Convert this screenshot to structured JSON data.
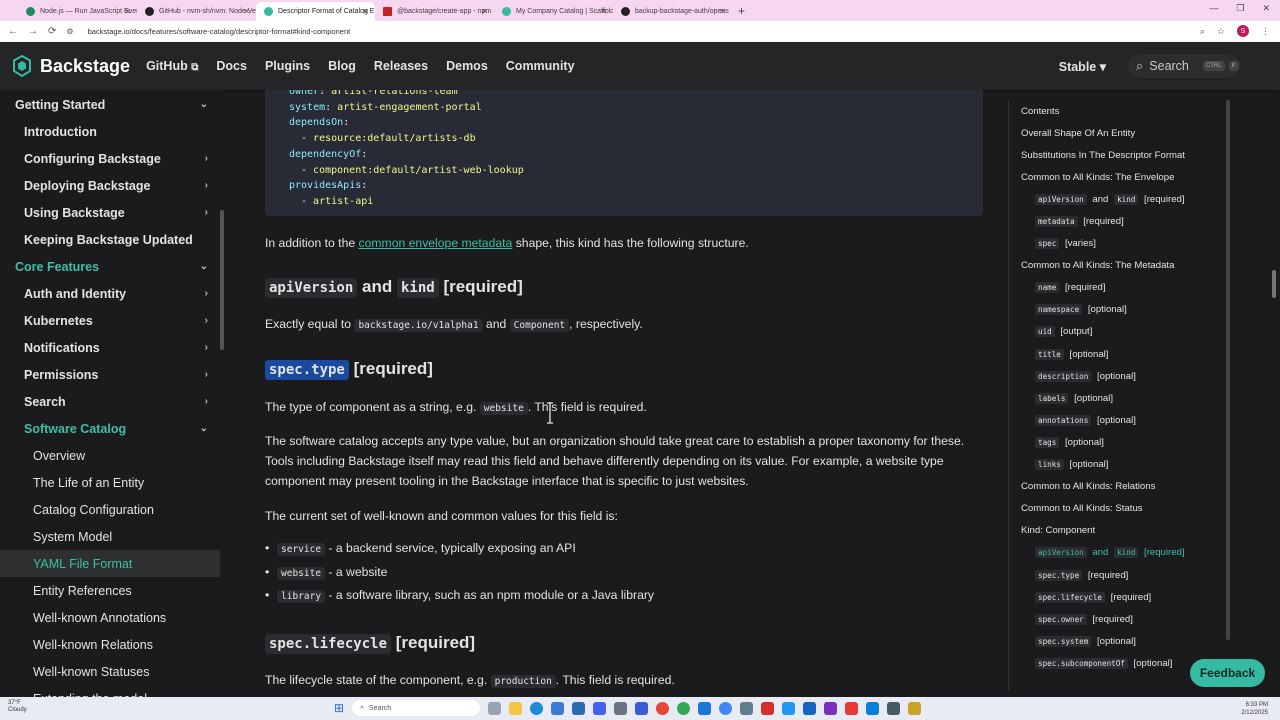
{
  "browser": {
    "tabs": [
      {
        "title": "Node.js — Run JavaScript Every",
        "icon": "node-icon",
        "active": false
      },
      {
        "title": "GitHub - nvm-sh/nvm: Node Ve",
        "icon": "github-icon",
        "active": false
      },
      {
        "title": "Descriptor Format of Catalog E",
        "icon": "backstage-icon",
        "active": true
      },
      {
        "title": "@backstage/create-app - npm",
        "icon": "npm-icon",
        "active": false
      },
      {
        "title": "My Company Catalog | Scaffold",
        "icon": "backstage-icon",
        "active": false
      },
      {
        "title": "backup-backstage-auth/opens",
        "icon": "github-icon",
        "active": false
      }
    ],
    "new_tab": "+",
    "url": "backstage.io/docs/features/software-catalog/descriptor-format#kind-component",
    "profile_initial": "S"
  },
  "navbar": {
    "logo": "Backstage",
    "links": [
      "GitHub",
      "Docs",
      "Plugins",
      "Blog",
      "Releases",
      "Demos",
      "Community"
    ],
    "version": "Stable",
    "search_label": "Search",
    "search_kbd": [
      "CTRL",
      "K"
    ]
  },
  "sidebar": {
    "items": [
      {
        "label": "Getting Started",
        "level": 1,
        "chev": "⌄",
        "cat": false
      },
      {
        "label": "Introduction",
        "level": 2,
        "chev": "",
        "cat": false
      },
      {
        "label": "Configuring Backstage",
        "level": 2,
        "chev": "›",
        "cat": false
      },
      {
        "label": "Deploying Backstage",
        "level": 2,
        "chev": "›",
        "cat": false
      },
      {
        "label": "Using Backstage",
        "level": 2,
        "chev": "›",
        "cat": false
      },
      {
        "label": "Keeping Backstage Updated",
        "level": 2,
        "chev": "",
        "cat": false
      },
      {
        "label": "Core Features",
        "level": 1,
        "chev": "⌄",
        "cat": true
      },
      {
        "label": "Auth and Identity",
        "level": 2,
        "chev": "›",
        "cat": false
      },
      {
        "label": "Kubernetes",
        "level": 2,
        "chev": "›",
        "cat": false
      },
      {
        "label": "Notifications",
        "level": 2,
        "chev": "›",
        "cat": false
      },
      {
        "label": "Permissions",
        "level": 2,
        "chev": "›",
        "cat": false
      },
      {
        "label": "Search",
        "level": 2,
        "chev": "›",
        "cat": false
      },
      {
        "label": "Software Catalog",
        "level": 2,
        "chev": "⌄",
        "cat": true
      },
      {
        "label": "Overview",
        "level": 3,
        "chev": "",
        "cat": false
      },
      {
        "label": "The Life of an Entity",
        "level": 3,
        "chev": "",
        "cat": false
      },
      {
        "label": "Catalog Configuration",
        "level": 3,
        "chev": "",
        "cat": false
      },
      {
        "label": "System Model",
        "level": 3,
        "chev": "",
        "cat": false
      },
      {
        "label": "YAML File Format",
        "level": 3,
        "chev": "",
        "cat": false,
        "active": true
      },
      {
        "label": "Entity References",
        "level": 3,
        "chev": "",
        "cat": false
      },
      {
        "label": "Well-known Annotations",
        "level": 3,
        "chev": "",
        "cat": false
      },
      {
        "label": "Well-known Relations",
        "level": 3,
        "chev": "",
        "cat": false
      },
      {
        "label": "Well-known Statuses",
        "level": 3,
        "chev": "",
        "cat": false
      },
      {
        "label": "Extending the model",
        "level": 3,
        "chev": "",
        "cat": false
      }
    ]
  },
  "code": {
    "lines": [
      {
        "indent": 0,
        "key": "owner",
        "val": "artist-relations-team"
      },
      {
        "indent": 0,
        "key": "system",
        "val": "artist-engagement-portal"
      },
      {
        "indent": 0,
        "key": "dependsOn",
        "val": ""
      },
      {
        "indent": 1,
        "key": "- ",
        "val": "resource:default/artists-db"
      },
      {
        "indent": 0,
        "key": "dependencyOf",
        "val": ""
      },
      {
        "indent": 1,
        "key": "- ",
        "val": "component:default/artist-web-lookup"
      },
      {
        "indent": 0,
        "key": "providesApis",
        "val": ""
      },
      {
        "indent": 1,
        "key": "- ",
        "val": "artist-api"
      }
    ]
  },
  "content": {
    "intro_pre": "In addition to the ",
    "intro_link": "common envelope metadata",
    "intro_post": " shape, this kind has the following structure.",
    "h_api_code1": "apiVersion",
    "h_api_and": "and",
    "h_api_code2": "kind",
    "h_api_req": "[required]",
    "api_text_pre": "Exactly equal to ",
    "api_code1": "backstage.io/v1alpha1",
    "api_text_and": " and ",
    "api_code2": "Component",
    "api_text_post": ", respectively.",
    "h_type_code": "spec.type",
    "h_type_req": "[required]",
    "type_text_pre": "The type of component as a string, e.g. ",
    "type_code": "website",
    "type_text_post": ". This field is required.",
    "type_para": "The software catalog accepts any type value, but an organization should take great care to establish a proper taxonomy for these. Tools including Backstage itself may read this field and behave differently depending on its value. For example, a website type component may present tooling in the Backstage interface that is specific to just websites.",
    "values_intro": "The current set of well-known and common values for this field is:",
    "values": [
      {
        "code": "service",
        "text": " - a backend service, typically exposing an API"
      },
      {
        "code": "website",
        "text": " - a website"
      },
      {
        "code": "library",
        "text": " - a software library, such as an npm module or a Java library"
      }
    ],
    "h_life_code": "spec.lifecycle",
    "h_life_req": "[required]",
    "life_text_pre": "The lifecycle state of the component, e.g. ",
    "life_code": "production",
    "life_text_post": ". This field is required."
  },
  "toc": {
    "title": "Contents",
    "items": [
      {
        "code": "",
        "text": "Overall Shape Of An Entity",
        "lv": 1
      },
      {
        "code": "",
        "text": "Substitutions In The Descriptor Format",
        "lv": 1
      },
      {
        "code": "",
        "text": "Common to All Kinds: The Envelope",
        "lv": 1
      },
      {
        "code": "apiVersion",
        "mid": " and ",
        "code2": "kind",
        "text": " [required]",
        "lv": 2
      },
      {
        "code": "metadata",
        "text": " [required]",
        "lv": 2
      },
      {
        "code": "spec",
        "text": " [varies]",
        "lv": 2
      },
      {
        "code": "",
        "text": "Common to All Kinds: The Metadata",
        "lv": 1
      },
      {
        "code": "name",
        "text": " [required]",
        "lv": 2
      },
      {
        "code": "namespace",
        "text": " [optional]",
        "lv": 2
      },
      {
        "code": "uid",
        "text": " [output]",
        "lv": 2
      },
      {
        "code": "title",
        "text": " [optional]",
        "lv": 2
      },
      {
        "code": "description",
        "text": " [optional]",
        "lv": 2
      },
      {
        "code": "labels",
        "text": " [optional]",
        "lv": 2
      },
      {
        "code": "annotations",
        "text": " [optional]",
        "lv": 2
      },
      {
        "code": "tags",
        "text": " [optional]",
        "lv": 2
      },
      {
        "code": "links",
        "text": " [optional]",
        "lv": 2
      },
      {
        "code": "",
        "text": "Common to All Kinds: Relations",
        "lv": 1
      },
      {
        "code": "",
        "text": "Common to All Kinds: Status",
        "lv": 1
      },
      {
        "code": "",
        "text": "Kind: Component",
        "lv": 1
      },
      {
        "code": "apiVersion",
        "mid": " and ",
        "code2": "kind",
        "text": " [required]",
        "lv": 2,
        "active": true
      },
      {
        "code": "spec.type",
        "text": " [required]",
        "lv": 2
      },
      {
        "code": "spec.lifecycle",
        "text": " [required]",
        "lv": 2
      },
      {
        "code": "spec.owner",
        "text": " [required]",
        "lv": 2
      },
      {
        "code": "spec.system",
        "text": " [optional]",
        "lv": 2
      },
      {
        "code": "spec.subcomponentOf",
        "text": " [optional]",
        "lv": 2
      }
    ]
  },
  "feedback": "Feedback",
  "taskbar": {
    "weather_temp": "37°F",
    "weather_desc": "Cloudy",
    "search": "Search",
    "time": "6:33 PM",
    "date": "2/12/2025"
  },
  "colors": {
    "accent": "#3ebfa6",
    "bg": "#1b1b1d",
    "navbar": "#242526",
    "highlight": "#1a4a9e"
  }
}
